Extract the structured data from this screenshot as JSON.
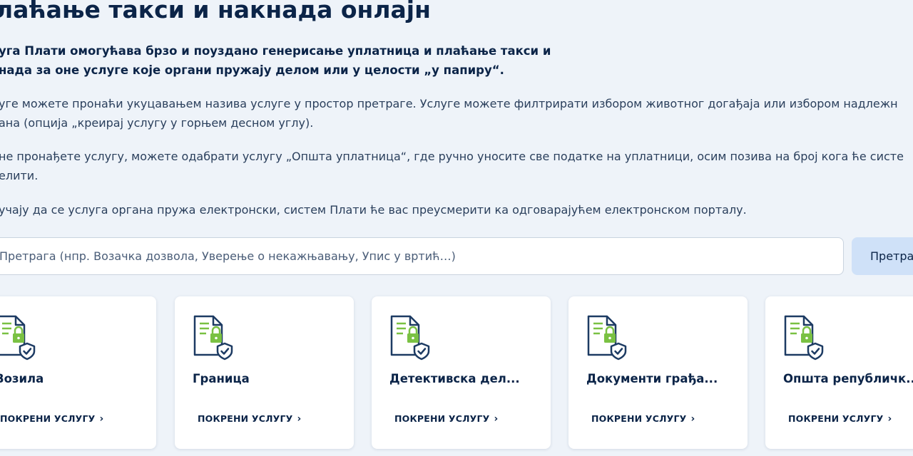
{
  "page": {
    "title": "лаћање такси и накнада онлајн",
    "lead_line1": "уга Плати омогућава брзо и поуздано генерисање уплатница и плаћање такси и",
    "lead_line2": "нада за оне услуге које органи пружају делом или у целости „у папиру“.",
    "p1_line1": "уге можете пронаћи укуцавањем назива услуге у простор претраге. Услуге можете филтрирати избором животног догађаја или избором надлежн",
    "p1_line2": "ана (опција „креирај услугу у горњем десном углу).",
    "p2_line1": "не пронађете услугу, можете одабрати услугу „Општа уплатница“, где ручно уносите све податке на уплатници, осим позива на број кога ће систе",
    "p2_line2": "елити.",
    "p3_line1": "учају да се услуга органа пружа електронски, систем Плати ће вас преусмерити ка одговарајућем електронском порталу."
  },
  "search": {
    "placeholder": "Претрага (нпр. Возачка дозвола, Уверење о некажњавању, Упис у вртић…)",
    "button_label": "Претраж"
  },
  "cards": [
    {
      "title": "Возила",
      "link": "ПОКРЕНИ УСЛУГУ",
      "icon": "document-lock-shield-icon"
    },
    {
      "title": "Граница",
      "link": "ПОКРЕНИ УСЛУГУ",
      "icon": "document-lock-shield-icon"
    },
    {
      "title": "Детективска дел...",
      "link": "ПОКРЕНИ УСЛУГУ",
      "icon": "document-lock-shield-icon"
    },
    {
      "title": "Документи грађа...",
      "link": "ПОКРЕНИ УСЛУГУ",
      "icon": "document-lock-shield-icon"
    },
    {
      "title": "Општа републичк...",
      "link": "ПОКРЕНИ УСЛУГУ",
      "icon": "document-lock-shield-icon"
    }
  ],
  "colors": {
    "background": "#eef3f9",
    "text_dark": "#0b2448",
    "icon_navy": "#1d3b63",
    "icon_green": "#7ac143",
    "search_button_bg": "#cfe1f8"
  }
}
